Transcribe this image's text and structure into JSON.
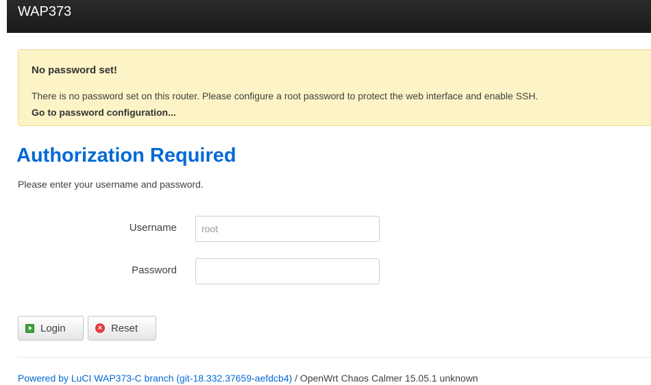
{
  "header": {
    "brand": "WAP373"
  },
  "alert": {
    "title": "No password set!",
    "message": "There is no password set on this router. Please configure a root password to protect the web interface and enable SSH.",
    "link": "Go to password configuration..."
  },
  "login": {
    "title": "Authorization Required",
    "subtitle": "Please enter your username and password.",
    "username_label": "Username",
    "username_placeholder": "root",
    "password_label": "Password",
    "password_value": "",
    "login_button": "Login",
    "reset_button": "Reset"
  },
  "footer": {
    "link": "Powered by LuCI WAP373-C branch (git-18.332.37659-aefdcb4)",
    "rest": " / OpenWrt Chaos Calmer 15.05.1 unknown"
  },
  "icons": {
    "login": "play-icon",
    "reset": "reset-icon"
  },
  "colors": {
    "topbar": "#1f1f1f",
    "alert_bg": "#fcf4c6",
    "title": "#0069d6",
    "link": "#0069d6"
  }
}
